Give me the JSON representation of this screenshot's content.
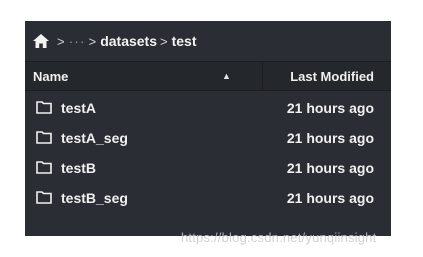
{
  "breadcrumb": {
    "home_icon": "home-icon",
    "separator": ">",
    "ellipsis": "···",
    "items": [
      "datasets",
      "test"
    ]
  },
  "table": {
    "columns": {
      "name": "Name",
      "last_modified": "Last Modified"
    },
    "sort_icon": "sort-ascending-icon",
    "rows": [
      {
        "icon": "folder-icon",
        "name": "testA",
        "modified": "21 hours ago"
      },
      {
        "icon": "folder-icon",
        "name": "testA_seg",
        "modified": "21 hours ago"
      },
      {
        "icon": "folder-icon",
        "name": "testB",
        "modified": "21 hours ago"
      },
      {
        "icon": "folder-icon",
        "name": "testB_seg",
        "modified": "21 hours ago"
      }
    ]
  },
  "watermark": "https://blog.csdn.net/yunqiinsight",
  "colors": {
    "panel_background": "#2a2d33",
    "header_background": "#24272c",
    "text": "#f0f0f0"
  }
}
